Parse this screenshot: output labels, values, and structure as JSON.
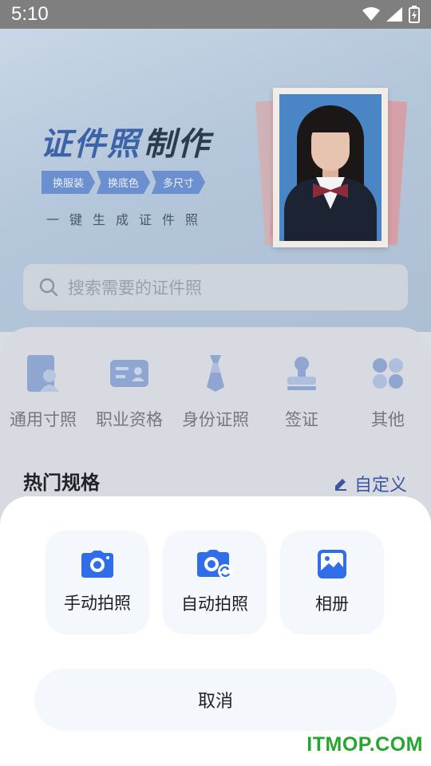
{
  "status_bar": {
    "time": "5:10"
  },
  "banner": {
    "title_part1": "证件照",
    "title_part2": "制作",
    "tags": [
      "换服装",
      "换底色",
      "多尺寸"
    ],
    "subtitle": "一键生成证件照"
  },
  "search": {
    "placeholder": "搜索需要的证件照"
  },
  "categories": [
    {
      "label": "通用寸照",
      "icon": "person-card-icon"
    },
    {
      "label": "职业资格",
      "icon": "id-card-icon"
    },
    {
      "label": "身份证照",
      "icon": "tie-icon"
    },
    {
      "label": "签证",
      "icon": "stamp-icon"
    },
    {
      "label": "其他",
      "icon": "grid-icon"
    }
  ],
  "hot_specs": {
    "title": "热门规格",
    "custom_label": "自定义"
  },
  "sheet": {
    "options": [
      {
        "label": "手动拍照",
        "icon": "camera-icon"
      },
      {
        "label": "自动拍照",
        "icon": "auto-camera-icon"
      },
      {
        "label": "相册",
        "icon": "album-icon"
      }
    ],
    "cancel_label": "取消"
  },
  "watermark": "ITMOP.COM",
  "colors": {
    "accent": "#2f6ee8",
    "dim_overlay": "#7f7f7f",
    "watermark": "#25a72e"
  }
}
